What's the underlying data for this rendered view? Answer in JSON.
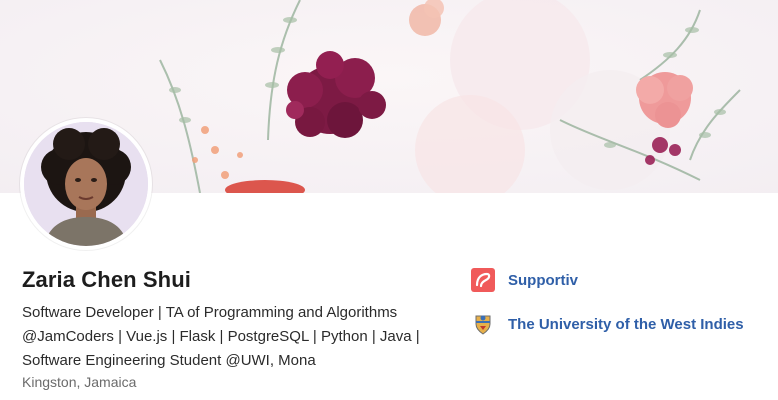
{
  "profile": {
    "name": "Zaria Chen Shui",
    "headline_lines": [
      "Software Developer | TA of Programming and Algorithms",
      "@JamCoders | Vue.js | Flask | PostgreSQL | Python | Java |",
      "Software Engineering Student @UWI, Mona"
    ],
    "location": "Kingston, Jamaica"
  },
  "affiliations": [
    {
      "name": "Supportiv",
      "icon": "supportiv-logo-icon"
    },
    {
      "name": "The University of the West Indies",
      "icon": "uwi-crest-icon"
    }
  ],
  "colors": {
    "link": "#2f5fa8",
    "name_text": "#1d1d1d",
    "secondary_text": "#6b6b6b",
    "supportiv_logo": "#f05a5a"
  }
}
